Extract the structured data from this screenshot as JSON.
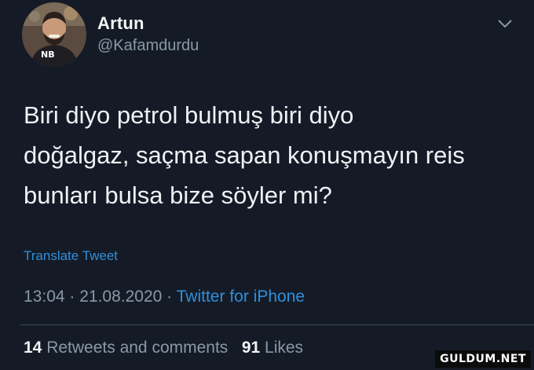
{
  "tweet": {
    "author_name": "Artun",
    "author_handle": "@Kafamdurdu",
    "avatar_text": "NB",
    "text": "Biri diyo petrol bulmuş biri diyo\ndoğalgaz, saçma sapan konuşmayın reis\nbunları bulsa bize söyler mi?",
    "translate_label": "Translate Tweet",
    "time": "13:04",
    "date": "21.08.2020",
    "separator": " · ",
    "source": "Twitter for iPhone",
    "retweets_count": "14",
    "retweets_label": "Retweets and comments",
    "likes_count": "91",
    "likes_label": "Likes"
  },
  "watermark": "GULDUM.NET",
  "icons": {
    "menu": "chevron-down-icon"
  },
  "colors": {
    "background": "#151b26",
    "link": "#2f8fdc",
    "secondary_text": "#8899a6",
    "primary_text": "#eef2f5",
    "divider": "#38444d"
  }
}
